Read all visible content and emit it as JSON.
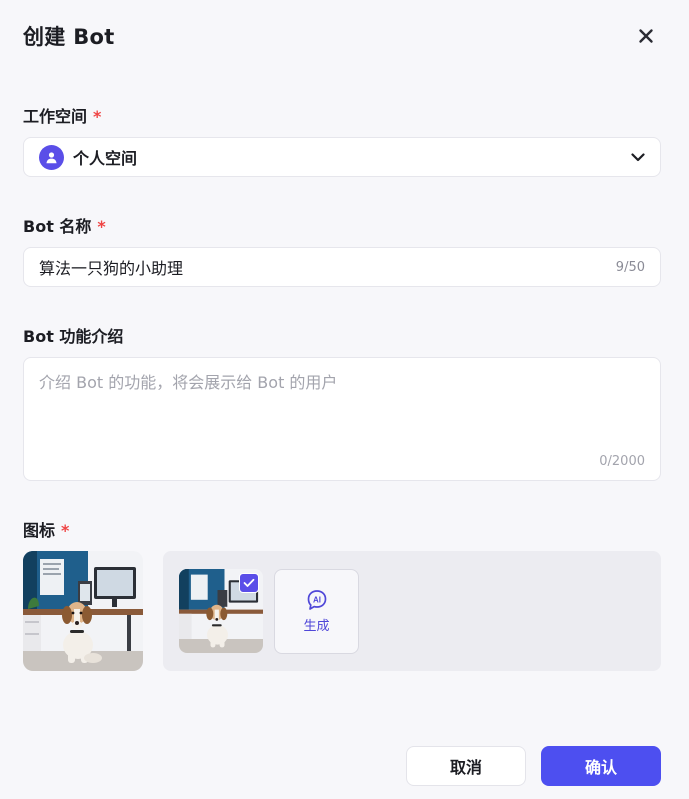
{
  "dialog": {
    "title": "创建 Bot",
    "close_icon": "close-icon"
  },
  "workspace": {
    "label": "工作空间",
    "required_mark": "*",
    "value": "个人空间",
    "icon": "user-icon",
    "dropdown_icon": "chevron-down-icon"
  },
  "name": {
    "label": "Bot 名称",
    "required_mark": "*",
    "value": "算法一只狗的小助理",
    "counter": "9/50"
  },
  "description": {
    "label": "Bot 功能介绍",
    "placeholder": "介绍 Bot 的功能，将会展示给 Bot 的用户",
    "value": "",
    "counter": "0/2000"
  },
  "icon_section": {
    "label": "图标",
    "required_mark": "*",
    "generate_label": "生成",
    "generate_icon": "ai-sparkle-icon",
    "selected_icon": "check-icon"
  },
  "footer": {
    "cancel_label": "取消",
    "confirm_label": "确认"
  },
  "colors": {
    "accent": "#4d4ff0",
    "required": "#ef4444",
    "background": "#f7f7fa"
  }
}
